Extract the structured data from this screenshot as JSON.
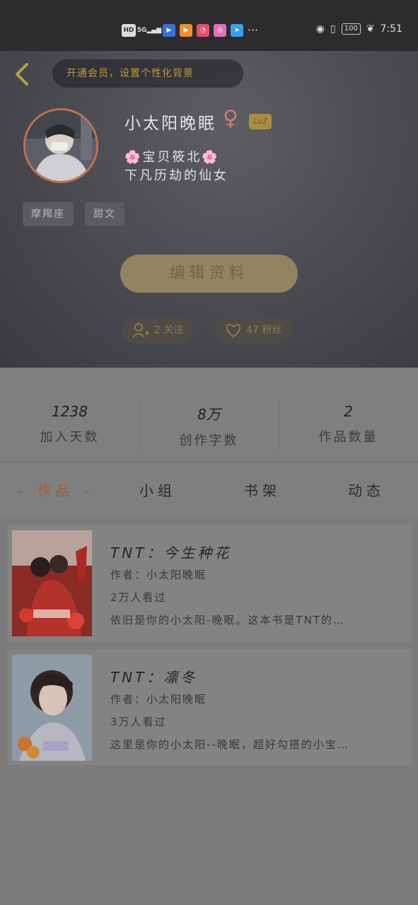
{
  "status_bar": {
    "hd": "HD",
    "signal": "5G",
    "time": "7:51",
    "battery": "100"
  },
  "header": {
    "vip_text": "开通会员，设置个性化背景",
    "username": "小太阳晚眠",
    "gender_symbol": "♀",
    "level": "Lv2",
    "bio_line1": "宝贝筱北",
    "bio_flower": "🌸",
    "bio_line2": "下凡历劫的仙女",
    "tags": [
      "摩羯座",
      "甜文"
    ],
    "edit_button": "编辑资料",
    "following": "2 关注",
    "fans": "47 粉丝"
  },
  "stats": [
    {
      "value": "1238",
      "label": "加入天数"
    },
    {
      "value": "8万",
      "label": "创作字数"
    },
    {
      "value": "2",
      "label": "作品数量"
    }
  ],
  "tabs": [
    {
      "label": "– 作品 –"
    },
    {
      "label": "小组"
    },
    {
      "label": "书架"
    },
    {
      "label": "动态"
    }
  ],
  "works": [
    {
      "title": "TNT：今生种花",
      "author": "作者：小太阳晚眠",
      "views": "2万人看过",
      "desc": "依旧是你的小太阳-晚眠。这本书是TNT的…"
    },
    {
      "title": "TNT：凛冬",
      "author": "作者：小太阳晚眠",
      "views": "3万人看过",
      "desc": "这里是你的小太阳--晚眠，超好勾搭的小宝…"
    }
  ],
  "colors": {
    "accent_gold": "#a88d43",
    "active_tab": "#a95a32",
    "header_bg": "#4e4e55"
  }
}
